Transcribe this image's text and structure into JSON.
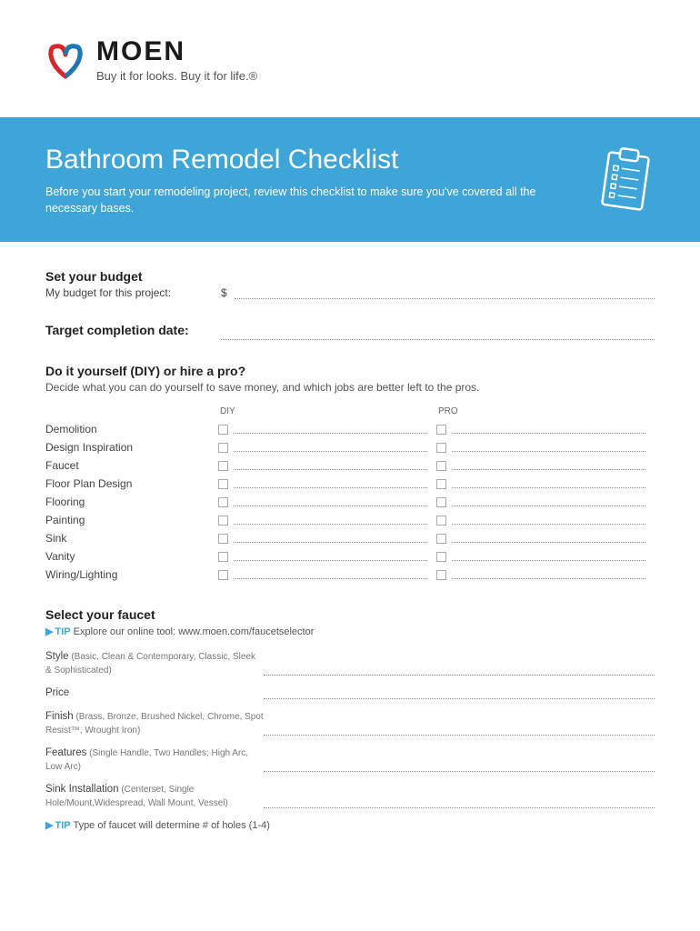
{
  "brand": "MOEN",
  "tagline": "Buy it for looks. Buy it for life.®",
  "banner": {
    "title": "Bathroom Remodel Checklist",
    "subtitle": "Before you start your remodeling project, review this checklist to make sure you've covered all the necessary bases."
  },
  "budget": {
    "title": "Set your budget",
    "label": "My budget for this project:",
    "prefix": "$"
  },
  "target_date": {
    "title": "Target completion date:"
  },
  "diy": {
    "title": "Do it yourself (DIY) or hire a pro?",
    "desc": "Decide what you can do yourself to save money, and which jobs are better left to the pros.",
    "col1": "DIY",
    "col2": "PRO",
    "items": [
      "Demolition",
      "Design Inspiration",
      "Faucet",
      "Floor Plan Design",
      "Flooring",
      "Painting",
      "Sink",
      "Vanity",
      "Wiring/Lighting"
    ]
  },
  "faucet": {
    "title": "Select your faucet",
    "tip1_prefix": "TIP",
    "tip1_text": " Explore our online tool: www.moen.com/faucetselector",
    "rows": [
      {
        "label": "Style",
        "sub": " (Basic, Clean & Contemporary, Classic, Sleek & Sophisticated)"
      },
      {
        "label": "Price",
        "sub": ""
      },
      {
        "label": "Finish",
        "sub": " (Brass, Bronze, Brushed Nickel, Chrome, Spot Resist™, Wrought Iron)"
      },
      {
        "label": "Features",
        "sub": " (Single Handle, Two Handles; High Arc, Low Arc)"
      },
      {
        "label": "Sink Installation",
        "sub": " (Centerset, Single Hole/Mount,Widespread, Wall Mount, Vessel)"
      }
    ],
    "tip2_prefix": "TIP",
    "tip2_text": " Type of faucet will determine # of holes (1-4)"
  }
}
